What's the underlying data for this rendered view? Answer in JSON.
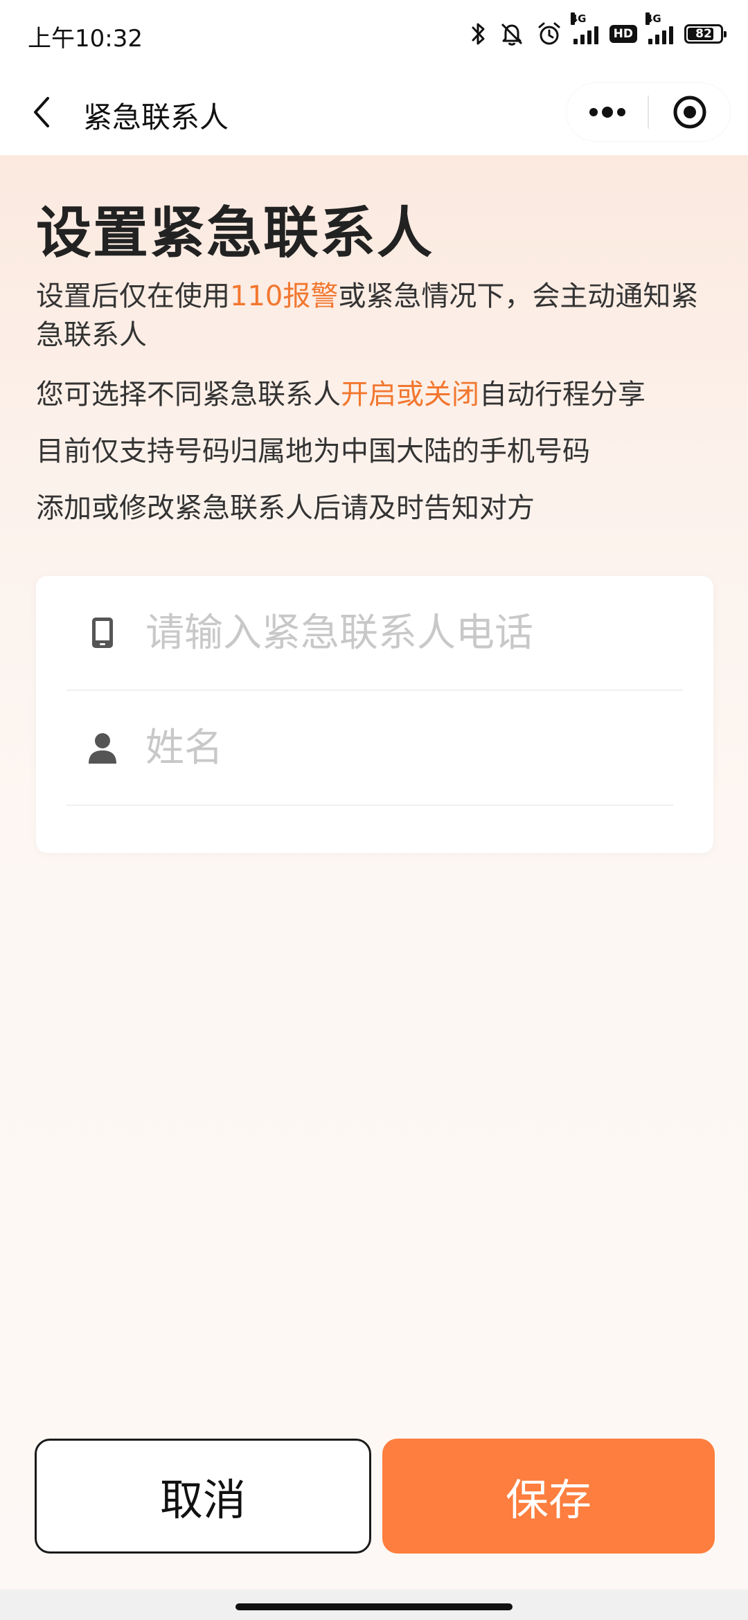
{
  "status_bar": {
    "time": "上午10:32",
    "network_1": "4G",
    "network_2": "4G",
    "hd": "HD",
    "battery": "82",
    "battery_fraction": 0.82
  },
  "nav": {
    "title": "紧急联系人",
    "icons": [
      "back-arrow-icon",
      "more-dots-icon",
      "close-target-icon"
    ]
  },
  "page": {
    "title": "设置紧急联系人",
    "lines": [
      {
        "parts": [
          {
            "text": "设置后仅在使用",
            "highlight": false
          },
          {
            "text": "110报警",
            "highlight": true
          },
          {
            "text": "或紧急情况下，会主动通知紧急联系人",
            "highlight": false
          }
        ]
      },
      {
        "parts": [
          {
            "text": "您可选择不同紧急联系人",
            "highlight": false
          },
          {
            "text": "开启或关闭",
            "highlight": true
          },
          {
            "text": "自动行程分享",
            "highlight": false
          }
        ]
      },
      {
        "parts": [
          {
            "text": "目前仅支持号码归属地为中国大陆的手机号码",
            "highlight": false
          }
        ]
      },
      {
        "parts": [
          {
            "text": "添加或修改紧急联系人后请及时告知对方",
            "highlight": false
          }
        ]
      }
    ]
  },
  "form": {
    "phone": {
      "value": "",
      "placeholder": "请输入紧急联系人电话",
      "icon": "phone-icon"
    },
    "name": {
      "value": "",
      "placeholder": "姓名",
      "icon": "person-icon"
    }
  },
  "buttons": {
    "cancel": "取消",
    "save": "保存"
  },
  "colors": {
    "accent": "#f2772f",
    "save_button": "#fd7e3e",
    "placeholder": "#c8c8c8"
  }
}
